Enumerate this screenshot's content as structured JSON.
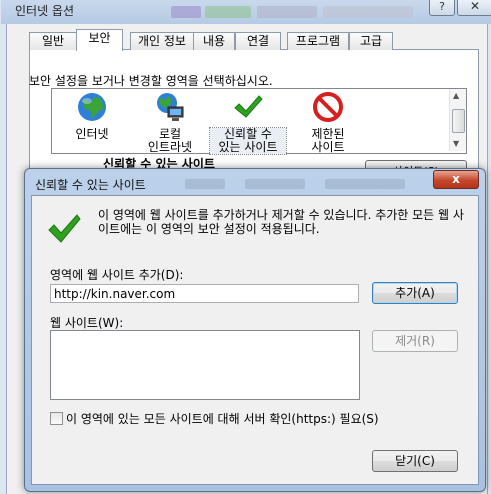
{
  "parent_window": {
    "title": "인터넷 옵션",
    "help_label": "?",
    "close_label": "✕",
    "tabs": [
      {
        "label": "일반"
      },
      {
        "label": "보안"
      },
      {
        "label": "개인 정보"
      },
      {
        "label": "내용"
      },
      {
        "label": "연결"
      },
      {
        "label": "프로그램"
      },
      {
        "label": "고급"
      }
    ],
    "active_tab": "보안",
    "zone_prompt": "보안 설정을 보거나 변경할 영역을 선택하십시오.",
    "zones": [
      {
        "label": "인터넷",
        "icon": "globe-icon"
      },
      {
        "label": "로컬\n인트라넷",
        "icon": "intranet-icon"
      },
      {
        "label": "신뢰할 수\n있는 사이트",
        "icon": "checkmark-icon"
      },
      {
        "label": "제한된\n사이트",
        "icon": "restricted-icon"
      }
    ],
    "selected_zone_heading": "신뢰할 수 있는 사이트",
    "sites_button_label": "사이트(S)"
  },
  "dialog": {
    "title": "신뢰할 수 있는 사이트",
    "close_label": "x",
    "info_text": "이 영역에 웹 사이트를 추가하거나 제거할 수 있습니다. 추가한 모든 웹 사이트에는 이 영역의 보안 설정이 적용됩니다.",
    "add_label": "영역에 웹 사이트 추가(D):",
    "url_value": "http://kin.naver.com",
    "add_button": "추가(A)",
    "sites_label": "웹 사이트(W):",
    "sites": [],
    "remove_button": "제거(R)",
    "https_label": "이 영역에 있는 모든 사이트에 대해 서버 확인(https:) 필요(S)",
    "https_checked": false,
    "close_button": "닫기(C)"
  },
  "colors": {
    "accent_green": "#2ea11f",
    "restricted_red": "#d42020",
    "dialog_frame": "#a9c2e1"
  }
}
